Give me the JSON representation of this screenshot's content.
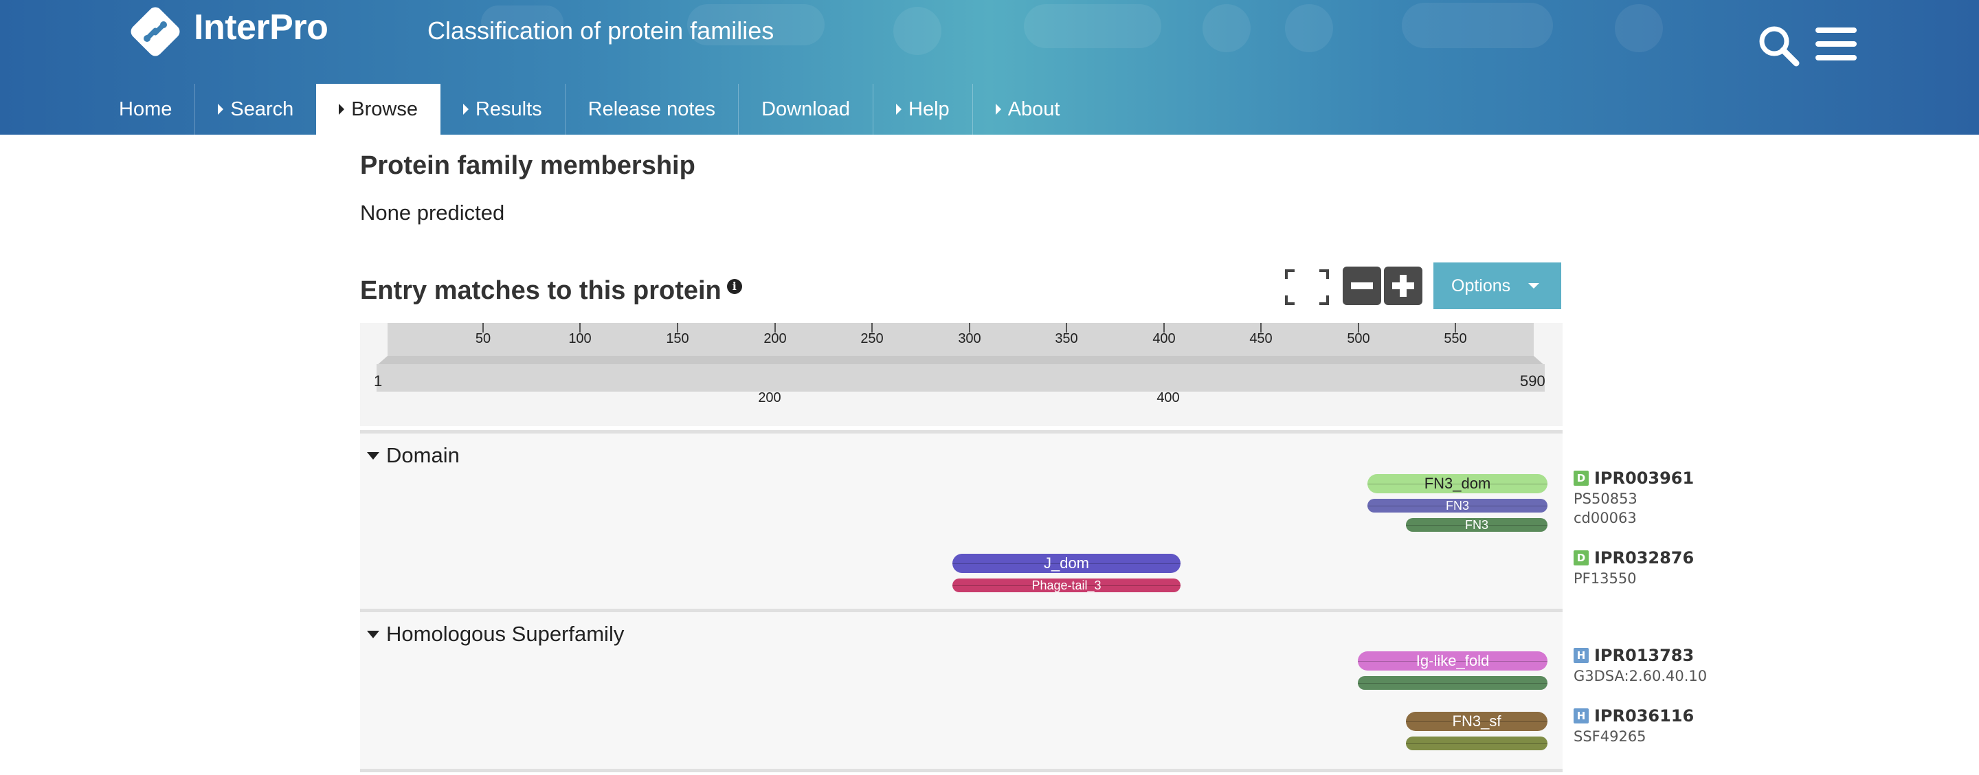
{
  "header": {
    "brand": "InterPro",
    "tagline": "Classification of protein families",
    "nav": [
      {
        "label": "Home"
      },
      {
        "label": "Search"
      },
      {
        "label": "Browse"
      },
      {
        "label": "Results"
      },
      {
        "label": "Release notes"
      },
      {
        "label": "Download"
      },
      {
        "label": "Help"
      },
      {
        "label": "About"
      }
    ]
  },
  "family": {
    "title": "Protein family membership",
    "value": "None predicted"
  },
  "entries": {
    "title": "Entry matches to this protein",
    "info_icon": "i",
    "options_label": "Options"
  },
  "ruler": {
    "ticks": [
      "50",
      "100",
      "150",
      "200",
      "250",
      "300",
      "350",
      "400",
      "450",
      "500",
      "550"
    ],
    "overview_ticks": [
      "200",
      "400"
    ],
    "start": "1",
    "end": "590"
  },
  "domain": {
    "title": "Domain",
    "tracks": [
      {
        "label": "FN3_dom",
        "color": "#a8e08e"
      },
      {
        "label": "FN3",
        "color": "#6a6ab4"
      },
      {
        "label": "FN3",
        "color": "#5a8a5a"
      },
      {
        "label": "J_dom",
        "color": "#5f55c4"
      },
      {
        "label": "Phage-tail_3",
        "color": "#c83c6c"
      }
    ],
    "entries": [
      {
        "badge": "D",
        "accession": "IPR003961",
        "members": [
          "PS50853",
          "cd00063"
        ]
      },
      {
        "badge": "D",
        "accession": "IPR032876",
        "members": [
          "PF13550"
        ]
      }
    ]
  },
  "superfamily": {
    "title": "Homologous Superfamily",
    "tracks": [
      {
        "label": "Ig-like_fold",
        "color": "#d576d1"
      },
      {
        "label": "",
        "color": "#5b8a5d"
      },
      {
        "label": "FN3_sf",
        "color": "#8c6c40"
      },
      {
        "label": "",
        "color": "#7f8c45"
      }
    ],
    "entries": [
      {
        "badge": "H",
        "accession": "IPR013783",
        "members": [
          "G3DSA:2.60.40.10"
        ]
      },
      {
        "badge": "H",
        "accession": "IPR036116",
        "members": [
          "SSF49265"
        ]
      }
    ]
  },
  "colors": {
    "domain_badge": "#6fbd5c",
    "superfamily_badge": "#6b9ccf",
    "options_button": "#5cb0c6",
    "header_start": "#2a64a3",
    "header_mid": "#55adc2"
  }
}
